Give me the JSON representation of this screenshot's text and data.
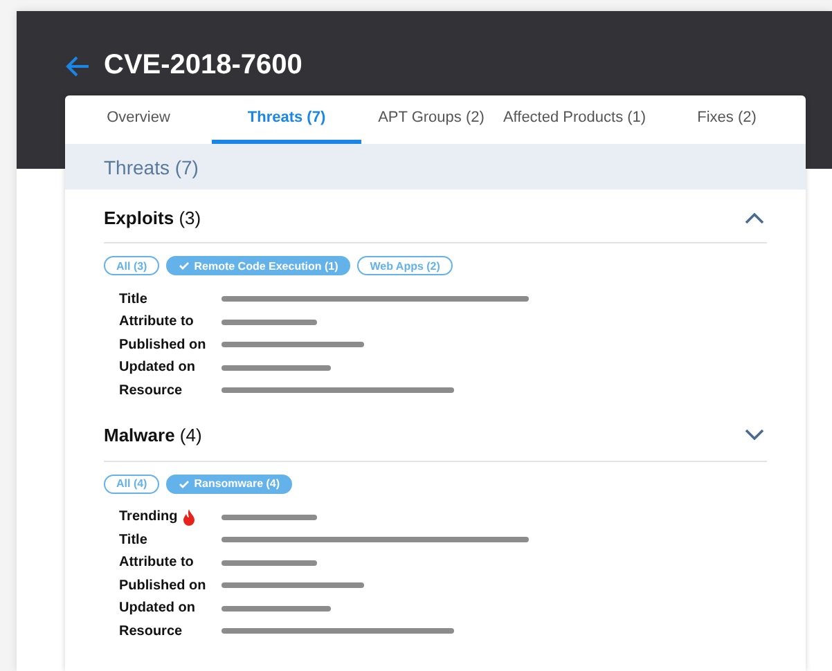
{
  "header": {
    "title": "CVE-2018-7600"
  },
  "tabs": [
    {
      "label": "Overview",
      "selected": false
    },
    {
      "label": "Threats (7)",
      "selected": true
    },
    {
      "label": "APT Groups (2)",
      "selected": false
    },
    {
      "label": "Affected Products (1)",
      "selected": false
    },
    {
      "label": "Fixes (2)",
      "selected": false
    }
  ],
  "panel_title": "Threats (7)",
  "sections": [
    {
      "name": "Exploits",
      "count": "(3)",
      "expanded": true,
      "chips": [
        {
          "label": "All (3)",
          "selected": false
        },
        {
          "label": "Remote Code Execution (1)",
          "selected": true
        },
        {
          "label": "Web Apps (2)",
          "selected": false
        }
      ],
      "fields": [
        {
          "label": "Title",
          "hot": false
        },
        {
          "label": "Attribute to",
          "hot": false
        },
        {
          "label": "Published on",
          "hot": false
        },
        {
          "label": "Updated on",
          "hot": false
        },
        {
          "label": "Resource",
          "hot": false
        }
      ]
    },
    {
      "name": "Malware",
      "count": "(4)",
      "expanded": false,
      "chips": [
        {
          "label": "All (4)",
          "selected": false
        },
        {
          "label": "Ransomware (4)",
          "selected": true
        }
      ],
      "fields": [
        {
          "label": "Trending",
          "hot": true
        },
        {
          "label": "Title",
          "hot": false
        },
        {
          "label": "Attribute to",
          "hot": false
        },
        {
          "label": "Published on",
          "hot": false
        },
        {
          "label": "Updated on",
          "hot": false
        },
        {
          "label": "Resource",
          "hot": false
        }
      ]
    }
  ]
}
